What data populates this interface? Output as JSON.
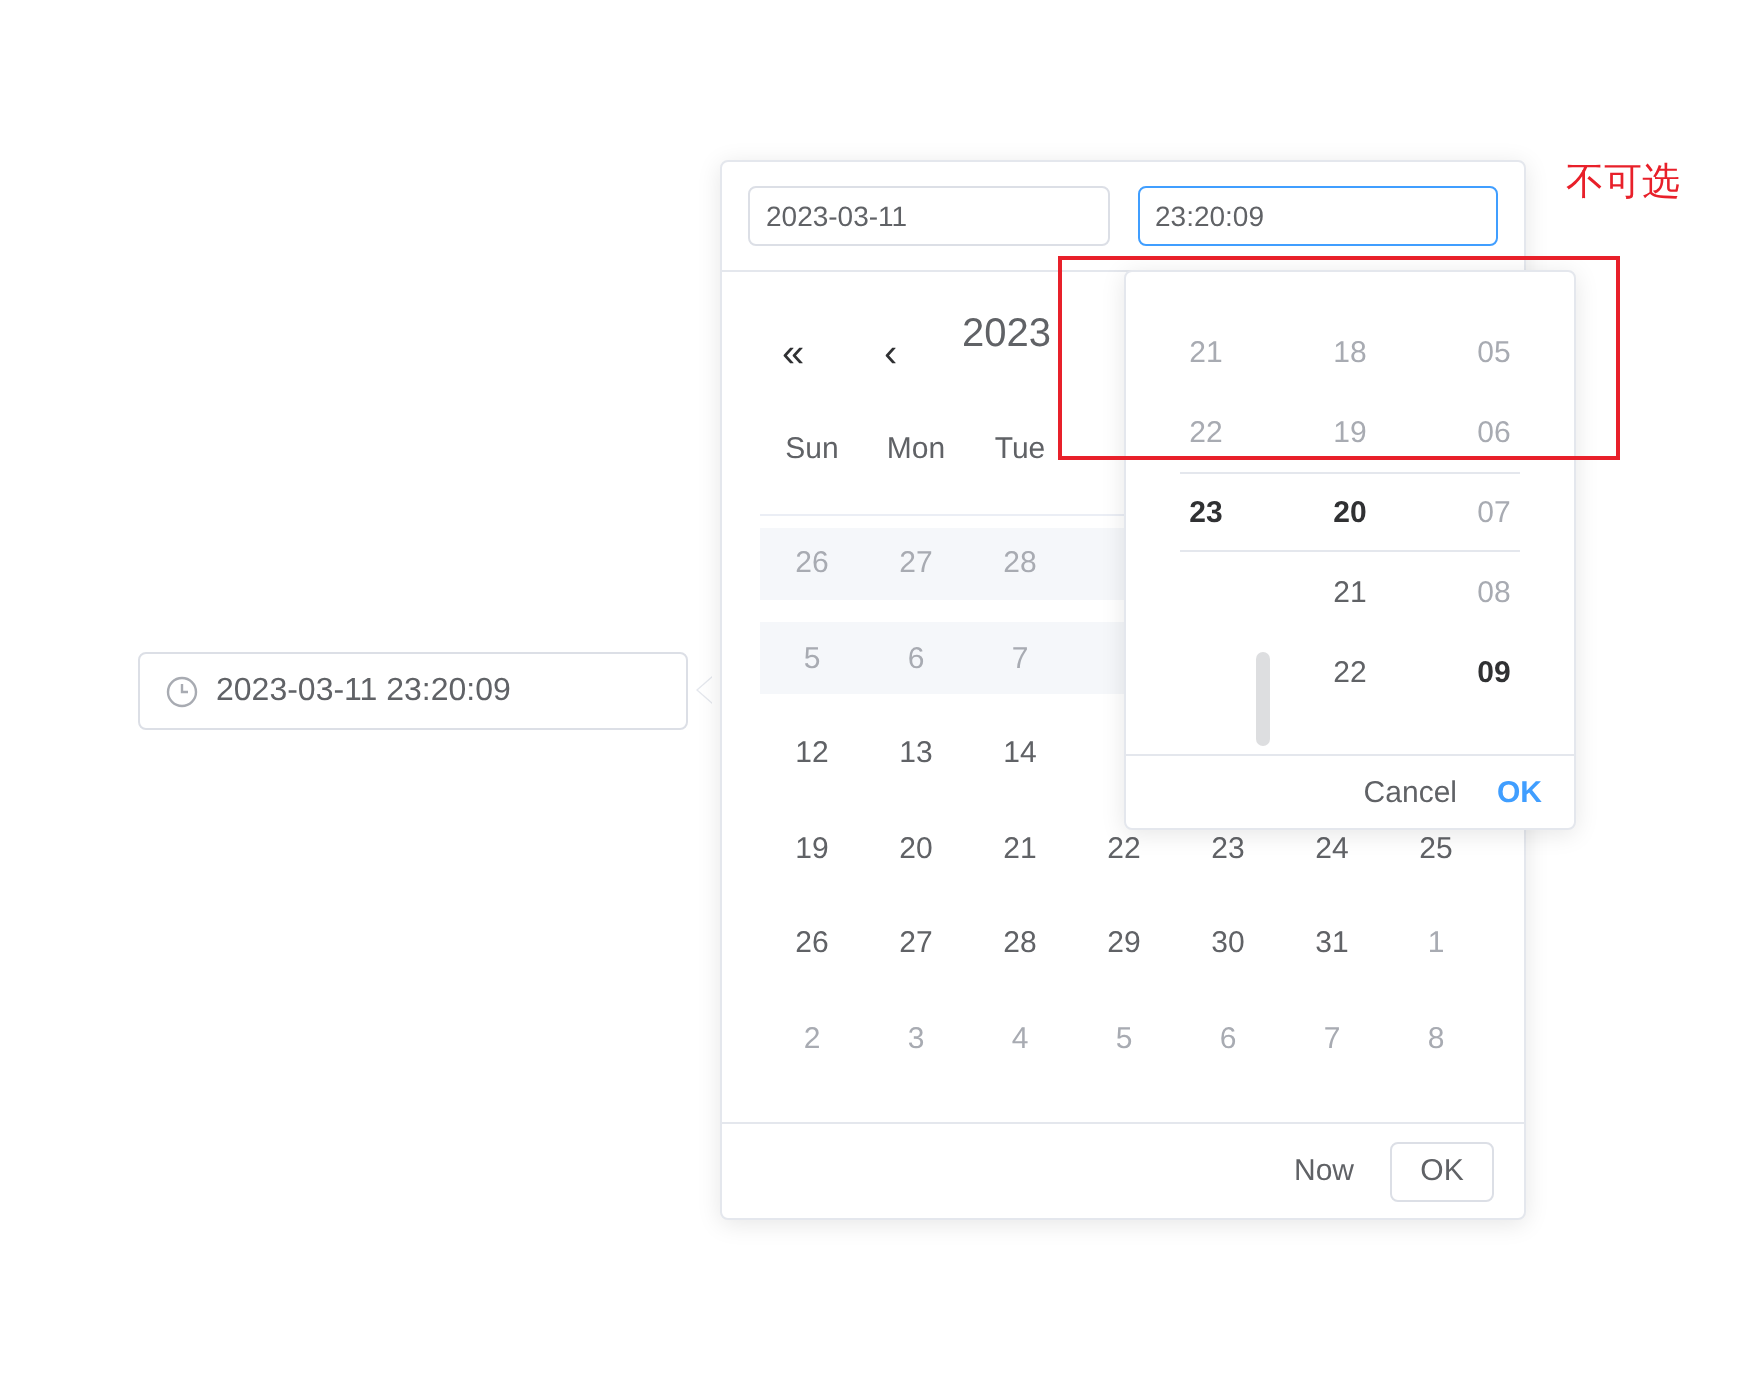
{
  "field": {
    "value": "2023-03-11 23:20:09"
  },
  "picker": {
    "date_input": {
      "value": "2023-03-11",
      "focused": false
    },
    "time_input": {
      "value": "23:20:09",
      "focused": true
    },
    "nav": [
      "«",
      "‹"
    ],
    "year": "2023",
    "weekdays": [
      "Sun",
      "Mon",
      "Tue"
    ],
    "weeks": [
      {
        "disabled": true,
        "days": [
          {
            "text": "26"
          },
          {
            "text": "27"
          },
          {
            "text": "28"
          }
        ]
      },
      {
        "disabled": true,
        "days": [
          {
            "text": "5"
          },
          {
            "text": "6"
          },
          {
            "text": "7"
          }
        ]
      },
      {
        "disabled": false,
        "days": [
          {
            "text": "12",
            "other_month": false
          },
          {
            "text": "13",
            "other_month": false
          },
          {
            "text": "14",
            "other_month": false
          }
        ]
      },
      {
        "disabled": false,
        "days": [
          {
            "text": "19",
            "other_month": false
          },
          {
            "text": "20",
            "other_month": false
          },
          {
            "text": "21",
            "other_month": false
          },
          {
            "text": "22",
            "other_month": false
          },
          {
            "text": "23",
            "other_month": false
          },
          {
            "text": "24",
            "other_month": false
          },
          {
            "text": "25",
            "other_month": false
          }
        ]
      },
      {
        "disabled": false,
        "days": [
          {
            "text": "26",
            "other_month": false
          },
          {
            "text": "27",
            "other_month": false
          },
          {
            "text": "28",
            "other_month": false
          },
          {
            "text": "29",
            "other_month": false
          },
          {
            "text": "30",
            "other_month": false
          },
          {
            "text": "31",
            "other_month": false
          },
          {
            "text": "1",
            "other_month": true
          }
        ]
      },
      {
        "disabled": false,
        "days": [
          {
            "text": "2",
            "other_month": true
          },
          {
            "text": "3",
            "other_month": true
          },
          {
            "text": "4",
            "other_month": true
          },
          {
            "text": "5",
            "other_month": true
          },
          {
            "text": "6",
            "other_month": true
          },
          {
            "text": "7",
            "other_month": true
          },
          {
            "text": "8",
            "other_month": true
          }
        ]
      }
    ],
    "footer_buttons": [
      "Now",
      "OK"
    ],
    "time_panel": {
      "columns": [
        [
          {
            "text": "21",
            "disabled": true,
            "selected": false
          },
          {
            "text": "22",
            "disabled": true,
            "selected": false
          },
          {
            "text": "23",
            "disabled": false,
            "selected": true
          }
        ],
        [
          {
            "text": "18",
            "disabled": true,
            "selected": false
          },
          {
            "text": "19",
            "disabled": true,
            "selected": false
          },
          {
            "text": "20",
            "disabled": false,
            "selected": true
          },
          {
            "text": "21",
            "disabled": false,
            "selected": false
          },
          {
            "text": "22",
            "disabled": false,
            "selected": false
          }
        ],
        [
          {
            "text": "05",
            "disabled": true,
            "selected": false
          },
          {
            "text": "06",
            "disabled": true,
            "selected": false
          },
          {
            "text": "07",
            "disabled": true,
            "selected": false
          },
          {
            "text": "08",
            "disabled": true,
            "selected": false
          },
          {
            "text": "09",
            "disabled": false,
            "selected": true
          }
        ]
      ],
      "cancel": "Cancel",
      "ok": "OK"
    }
  },
  "annotation": {
    "text": "不可选"
  }
}
